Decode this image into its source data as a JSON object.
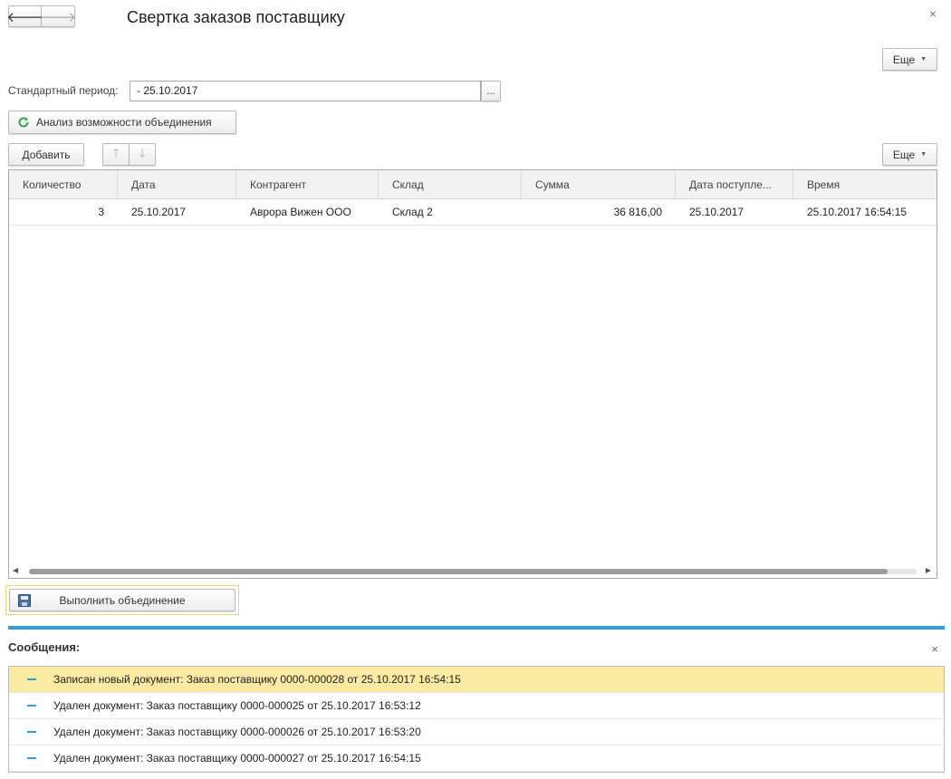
{
  "window": {
    "title": "Свертка заказов поставщику",
    "close_glyph": "×",
    "back_glyph": "🡐",
    "forward_glyph": "🡒"
  },
  "toolbar": {
    "more_label": "Еще",
    "analyze_label": "Анализ возможности объединения",
    "add_label": "Добавить",
    "table_more_label": "Еще",
    "up_glyph": "🡑",
    "down_glyph": "🡓"
  },
  "period": {
    "label": "Стандартный период:",
    "value": "- 25.10.2017",
    "select_glyph": "..."
  },
  "table": {
    "columns": [
      "Количество",
      "Дата",
      "Контрагент",
      "Склад",
      "Сумма",
      "Дата поступле...",
      "Время"
    ],
    "rows": [
      {
        "qty": "3",
        "date": "25.10.2017",
        "counterparty": "Аврора Вижен ООО",
        "warehouse": "Склад 2",
        "sum": "36 816,00",
        "arrival": "25.10.2017",
        "time": "25.10.2017 16:54:15"
      }
    ]
  },
  "execute": {
    "label": "Выполнить объединение"
  },
  "messages": {
    "title": "Сообщения:",
    "close_glyph": "×",
    "items": [
      "Записан новый документ: Заказ поставщику 0000-000028 от 25.10.2017 16:54:15",
      "Удален документ: Заказ поставщику 0000-000025 от 25.10.2017 16:53:12",
      "Удален документ: Заказ поставщику 0000-000026 от 25.10.2017 16:53:20",
      "Удален документ: Заказ поставщику 0000-000027 от 25.10.2017 16:54:15"
    ]
  },
  "colors": {
    "accent": "#2f9fd9",
    "highlight": "#fbeaa2",
    "refresh_icon": "#2fa84f"
  }
}
